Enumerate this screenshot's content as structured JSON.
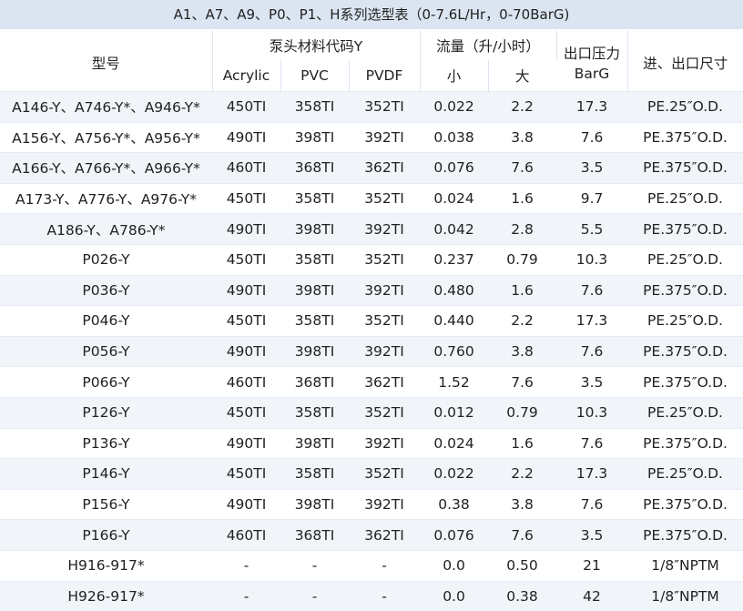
{
  "title": "A1、A7、A9、P0、P1、H系列选型表（0-7.6L/Hr，0-70BarG)",
  "headers": {
    "model": "型号",
    "pump_head_code": "泵头材料代码Y",
    "acrylic": "Acrylic",
    "pvc": "PVC",
    "pvdf": "PVDF",
    "flow": "流量（升/小时）",
    "flow_small": "小",
    "flow_large": "大",
    "outlet_pressure": "出口压力",
    "outlet_pressure_unit": "BarG",
    "port_size": "进、出口尺寸"
  },
  "rows": [
    [
      "A146-Y、A746-Y*、A946-Y*",
      "450TI",
      "358TI",
      "352TI",
      "0.022",
      "2.2",
      "17.3",
      "PE.25″O.D."
    ],
    [
      "A156-Y、A756-Y*、A956-Y*",
      "490TI",
      "398TI",
      "392TI",
      "0.038",
      "3.8",
      "7.6",
      "PE.375″O.D."
    ],
    [
      "A166-Y、A766-Y*、A966-Y*",
      "460TI",
      "368TI",
      "362TI",
      "0.076",
      "7.6",
      "3.5",
      "PE.375″O.D."
    ],
    [
      "A173-Y、A776-Y、A976-Y*",
      "450TI",
      "358TI",
      "352TI",
      "0.024",
      "1.6",
      "9.7",
      "PE.25″O.D."
    ],
    [
      "A186-Y、A786-Y*",
      "490TI",
      "398TI",
      "392TI",
      "0.042",
      "2.8",
      "5.5",
      "PE.375″O.D."
    ],
    [
      "P026-Y",
      "450TI",
      "358TI",
      "352TI",
      "0.237",
      "0.79",
      "10.3",
      "PE.25″O.D."
    ],
    [
      "P036-Y",
      "490TI",
      "398TI",
      "392TI",
      "0.480",
      "1.6",
      "7.6",
      "PE.375″O.D."
    ],
    [
      "P046-Y",
      "450TI",
      "358TI",
      "352TI",
      "0.440",
      "2.2",
      "17.3",
      "PE.25″O.D."
    ],
    [
      "P056-Y",
      "490TI",
      "398TI",
      "392TI",
      "0.760",
      "3.8",
      "7.6",
      "PE.375″O.D."
    ],
    [
      "P066-Y",
      "460TI",
      "368TI",
      "362TI",
      "1.52",
      "7.6",
      "3.5",
      "PE.375″O.D."
    ],
    [
      "P126-Y",
      "450TI",
      "358TI",
      "352TI",
      "0.012",
      "0.79",
      "10.3",
      "PE.25″O.D."
    ],
    [
      "P136-Y",
      "490TI",
      "398TI",
      "392TI",
      "0.024",
      "1.6",
      "7.6",
      "PE.375″O.D."
    ],
    [
      "P146-Y",
      "450TI",
      "358TI",
      "352TI",
      "0.022",
      "2.2",
      "17.3",
      "PE.25″O.D."
    ],
    [
      "P156-Y",
      "490TI",
      "398TI",
      "392TI",
      "0.38",
      "3.8",
      "7.6",
      "PE.375″O.D."
    ],
    [
      "P166-Y",
      "460TI",
      "368TI",
      "362TI",
      "0.076",
      "7.6",
      "3.5",
      "PE.375″O.D."
    ],
    [
      "H916-917*",
      "-",
      "-",
      "-",
      "0.0",
      "0.50",
      "21",
      "1/8″NPTM"
    ],
    [
      "H926-917*",
      "-",
      "-",
      "-",
      "0.0",
      "0.38",
      "42",
      "1/8″NPTM"
    ]
  ]
}
